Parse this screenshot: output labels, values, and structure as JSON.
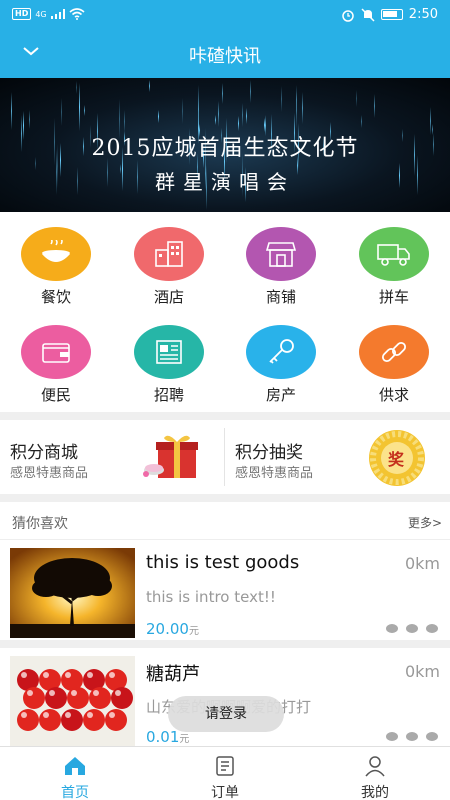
{
  "status": {
    "net": "4G",
    "hd": "HD",
    "time": "2:50"
  },
  "header": {
    "title": "咔碴快讯"
  },
  "banner": {
    "line1": "2015应城首届生态文化节",
    "line2": "群星演唱会"
  },
  "categories": [
    {
      "label": "餐饮",
      "icon": "food-bowl-icon",
      "color": "#f6ac1a"
    },
    {
      "label": "酒店",
      "icon": "hotel-icon",
      "color": "#f0696c"
    },
    {
      "label": "商铺",
      "icon": "shop-icon",
      "color": "#b356b0"
    },
    {
      "label": "拼车",
      "icon": "truck-icon",
      "color": "#62c45a"
    },
    {
      "label": "便民",
      "icon": "wallet-icon",
      "color": "#ec5da0"
    },
    {
      "label": "招聘",
      "icon": "newspaper-icon",
      "color": "#26b6a7"
    },
    {
      "label": "房产",
      "icon": "key-icon",
      "color": "#29b2ea"
    },
    {
      "label": "供求",
      "icon": "link-icon",
      "color": "#f47a2d"
    }
  ],
  "points": {
    "mall": {
      "title": "积分商城",
      "subtitle": "感恩特惠商品"
    },
    "lottery": {
      "title": "积分抽奖",
      "subtitle": "感恩特惠商品",
      "badge": "奖"
    }
  },
  "guess": {
    "title": "猜你喜欢",
    "more": "更多>"
  },
  "products": [
    {
      "name": "this is test goods",
      "distance": "0km",
      "intro": "this is intro text!!",
      "price": "20.00",
      "unit": "元"
    },
    {
      "name": "糖葫芦",
      "distance": "0km",
      "intro": "山东爱的啊啊啊爱的打打",
      "price": "0.01",
      "unit": "元"
    }
  ],
  "toast": {
    "text": "请登录"
  },
  "tabs": [
    {
      "label": "首页",
      "icon": "home-icon"
    },
    {
      "label": "订单",
      "icon": "order-list-icon"
    },
    {
      "label": "我的",
      "icon": "user-icon"
    }
  ],
  "colors": {
    "primary": "#28b0e6",
    "price": "#29a8e0"
  }
}
